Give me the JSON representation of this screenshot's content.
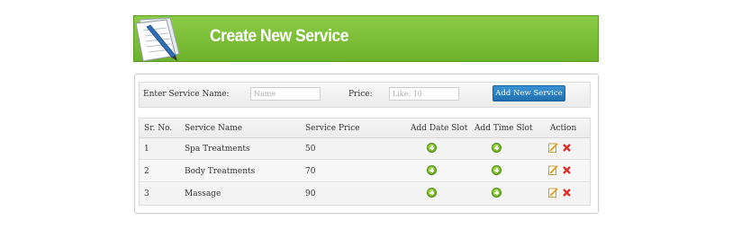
{
  "header": {
    "title": "Create New Service",
    "icon": "paper-pen-icon",
    "accent_color": "#6db22c"
  },
  "form": {
    "service_name_label": "Enter Service Name:",
    "service_name_placeholder": "Name",
    "service_name_value": "",
    "price_label": "Price:",
    "price_placeholder": "Like: 10",
    "price_value": "",
    "add_button_label": "Add New Service",
    "button_color": "#2a7fc1"
  },
  "table": {
    "columns": [
      "Sr. No.",
      "Service Name",
      "Service Price",
      "Add Date Slot",
      "Add Time Slot",
      "Action"
    ],
    "rows": [
      {
        "sr": "1",
        "name": "Spa Treatments",
        "price": "50"
      },
      {
        "sr": "2",
        "name": "Body Treatments",
        "price": "70"
      },
      {
        "sr": "3",
        "name": "Massage",
        "price": "90"
      }
    ],
    "row_icons": {
      "date_slot": "add-date-slot-icon",
      "time_slot": "add-time-slot-icon",
      "edit": "edit-icon",
      "delete": "delete-icon"
    }
  }
}
